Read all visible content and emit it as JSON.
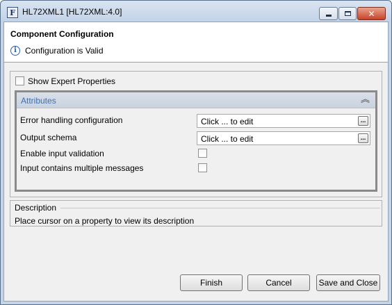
{
  "window": {
    "title": "HL72XML1 [HL72XML:4.0]",
    "app_icon_letter": "F",
    "controls": {
      "minimize": "minimize-icon",
      "maximize": "maximize-icon",
      "close": "✕"
    }
  },
  "header": {
    "title": "Component Configuration",
    "status": "Configuration is Valid",
    "status_icon": "info-icon"
  },
  "properties": {
    "show_expert_label": "Show Expert Properties",
    "show_expert_checked": false,
    "section_title": "Attributes",
    "collapse_icon": "⌃",
    "rows": [
      {
        "label": "Error handling configuration",
        "value": "Click ... to edit",
        "button": "..."
      },
      {
        "label": "Output schema",
        "value": "Click ... to edit",
        "button": "..."
      },
      {
        "label": "Enable input validation",
        "checked": false
      },
      {
        "label": "Input contains multiple messages",
        "checked": false
      }
    ]
  },
  "description": {
    "title": "Description",
    "text": "Place cursor on a property to view its description"
  },
  "buttons": {
    "finish": "Finish",
    "cancel": "Cancel",
    "save_and_close": "Save and Close"
  },
  "colors": {
    "title_bar": "#c2d3e8",
    "section_title": "#3b6fb6",
    "close_button": "#c8442a"
  }
}
